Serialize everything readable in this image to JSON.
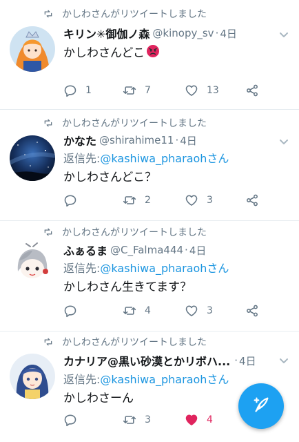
{
  "tweets": [
    {
      "retweet_text": "かしわさんがリツイートしました",
      "display_name": "キリン✳御伽ノ森",
      "handle": "@kinopy_sv",
      "dot": "·",
      "time": "4日",
      "reply_label": "",
      "reply_target": "",
      "text": "かしわさんどこ",
      "emoji": "angry-face",
      "reply_count": "1",
      "retweet_count": "7",
      "like_count": "13",
      "liked": false
    },
    {
      "retweet_text": "かしわさんがリツイートしました",
      "display_name": "かなた",
      "handle": "@shirahime11",
      "dot": "·",
      "time": "4日",
      "reply_label": "返信先: ",
      "reply_target": "@kashiwa_pharaohさん",
      "text": "かしわさんどこ？",
      "reply_count": "",
      "retweet_count": "2",
      "like_count": "3",
      "liked": false
    },
    {
      "retweet_text": "かしわさんがリツイートしました",
      "display_name": "ふぁるま",
      "handle": "@C_Falma444",
      "dot": "·",
      "time": "4日",
      "reply_label": "返信先: ",
      "reply_target": "@kashiwa_pharaohさん",
      "text": "かしわさん生きてます？",
      "reply_count": "",
      "retweet_count": "4",
      "like_count": "3",
      "liked": false
    },
    {
      "retweet_text": "かしわさんがリツイートしました",
      "display_name": "カナリア@黒い砂漠とかリボハ...",
      "handle": "",
      "dot": "·",
      "time": "4日",
      "reply_label": "返信先: ",
      "reply_target": "@kashiwa_pharaohさん",
      "text": "かしわさーん",
      "reply_count": "",
      "retweet_count": "3",
      "like_count": "4",
      "liked": true
    }
  ],
  "colors": {
    "accent": "#1da1f2",
    "link": "#1b95e0",
    "secondary_text": "#657786",
    "like_active": "#e0245e",
    "divider": "#e6ecf0"
  },
  "icons": {
    "retweet_context": "retweet-icon",
    "reply": "reply-icon",
    "retweet": "retweet-icon",
    "like": "heart-icon",
    "share": "share-icon",
    "menu": "chevron-down-icon",
    "compose": "compose-feather-icon"
  }
}
